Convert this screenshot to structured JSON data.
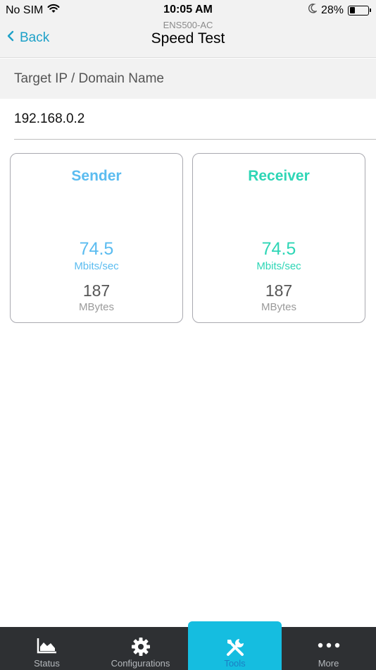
{
  "status_bar": {
    "carrier": "No SIM",
    "time": "10:05 AM",
    "battery": "28%",
    "battery_level": 0.28
  },
  "nav": {
    "back_label": "Back",
    "device_name": "ENS500-AC",
    "title": "Speed Test"
  },
  "target": {
    "label": "Target IP / Domain Name",
    "value": "192.168.0.2"
  },
  "sender": {
    "title": "Sender",
    "rate": "74.5",
    "rate_unit": "Mbits/sec",
    "size": "187",
    "size_unit": "MBytes"
  },
  "receiver": {
    "title": "Receiver",
    "rate": "74.5",
    "rate_unit": "Mbits/sec",
    "size": "187",
    "size_unit": "MBytes"
  },
  "tabs": [
    {
      "label": "Status",
      "icon": "area-chart-icon"
    },
    {
      "label": "Configurations",
      "icon": "gear-icon"
    },
    {
      "label": "Tools",
      "icon": "tools-icon",
      "active": true
    },
    {
      "label": "More",
      "icon": "more-dots-icon"
    }
  ],
  "colors": {
    "accent": "#1ea1c8",
    "sender": "#5bbcf0",
    "receiver": "#2ed6b6",
    "tab_active": "#15bde0",
    "tab_bar": "#2e3033"
  }
}
